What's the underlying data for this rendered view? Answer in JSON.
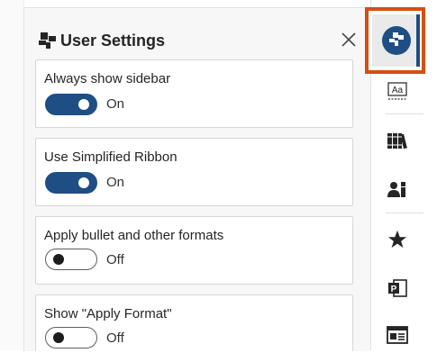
{
  "panel": {
    "title": "User Settings",
    "close_glyph": "✕"
  },
  "settings": [
    {
      "label": "Always show sidebar",
      "state": "On",
      "on": true
    },
    {
      "label": "Use Simplified Ribbon",
      "state": "On",
      "on": true
    },
    {
      "label": "Apply bullet and other formats",
      "state": "Off",
      "on": false
    },
    {
      "label": "Show \"Apply Format\"",
      "state": "Off",
      "on": false
    }
  ],
  "rail": {
    "items": [
      {
        "icon": "user-settings-icon",
        "active": true
      },
      {
        "icon": "font-styles-icon"
      },
      {
        "icon": "library-icon"
      },
      {
        "icon": "people-icon"
      },
      {
        "icon": "star-icon"
      },
      {
        "icon": "powerpoint-icon"
      },
      {
        "icon": "layout-icon"
      }
    ],
    "font_icon_text": "Aa",
    "powerpoint_icon_text": "P"
  },
  "colors": {
    "accent": "#1f4e84",
    "highlight_border": "#d64e12",
    "panel_bg": "#f7f7f7"
  }
}
